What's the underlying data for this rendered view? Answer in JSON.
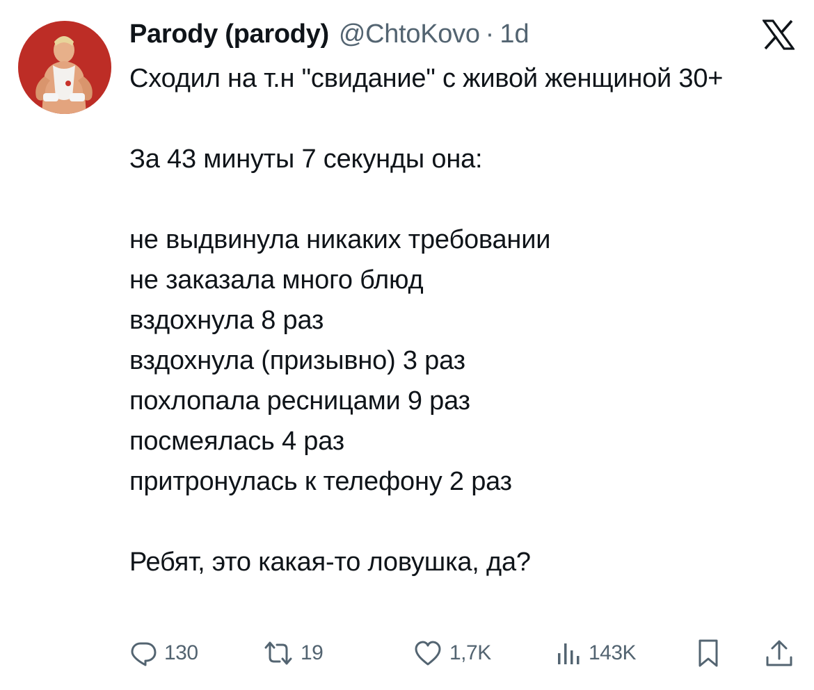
{
  "tweet": {
    "author": {
      "display_name": "Parody (parody)",
      "handle": "@ChtoKovo",
      "separator": "·",
      "time": "1d",
      "avatar_icon": "avatar-photo"
    },
    "platform_icon": "x-logo-icon",
    "lines": [
      "Сходил на т.н \"свидание\" с живой женщиной 30+",
      "За 43 минуты 7 секунды она:",
      "не выдвинула никаких требовании",
      "не заказала много блюд",
      "вздохнула 8 раз",
      "вздохнула (призывно) 3 раз",
      "похлопала ресницами 9 раз",
      "посмеялась 4 раз",
      "притронулась к телефону 2 раз",
      "Ребят, это какая-то ловушка, да?"
    ],
    "actions": {
      "reply": {
        "icon": "reply-icon",
        "count": "130"
      },
      "retweet": {
        "icon": "retweet-icon",
        "count": "19"
      },
      "like": {
        "icon": "heart-icon",
        "count": "1,7K"
      },
      "views": {
        "icon": "views-icon",
        "count": "143K"
      },
      "bookmark": {
        "icon": "bookmark-icon"
      },
      "share": {
        "icon": "share-icon"
      }
    }
  },
  "colors": {
    "text_primary": "#0f1419",
    "text_secondary": "#536471",
    "avatar_background": "#c8322a"
  }
}
